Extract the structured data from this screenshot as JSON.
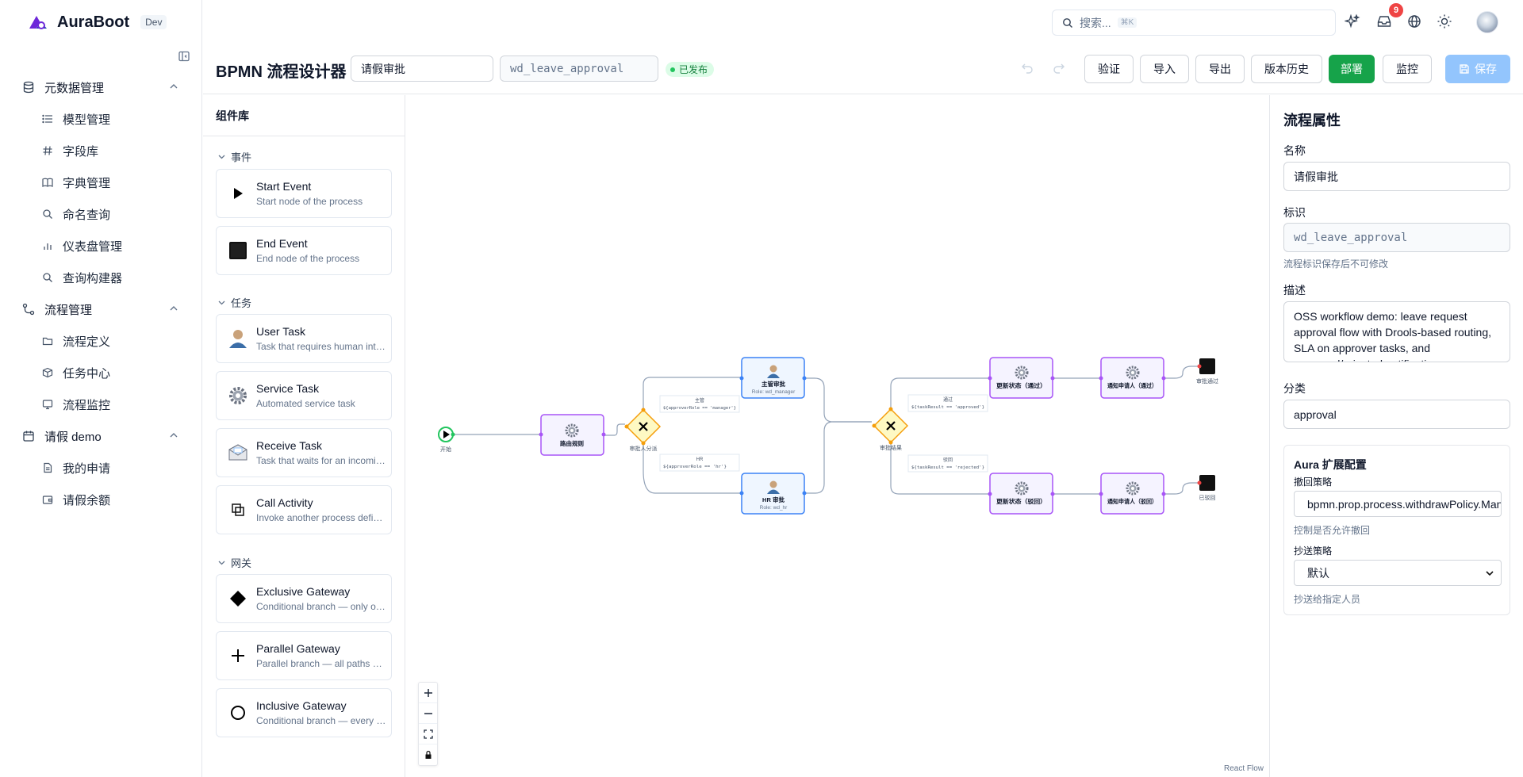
{
  "app": {
    "name": "AuraBoot",
    "env": "Dev"
  },
  "search": {
    "placeholder": "搜索...",
    "shortcut": "⌘K"
  },
  "notifications": {
    "count": "9"
  },
  "sidebar": {
    "groups": [
      {
        "label": "元数据管理",
        "items": [
          "模型管理",
          "字段库",
          "字典管理",
          "命名查询",
          "仪表盘管理",
          "查询构建器"
        ]
      },
      {
        "label": "流程管理",
        "items": [
          "流程定义",
          "任务中心",
          "流程监控"
        ]
      },
      {
        "label": "请假 demo",
        "items": [
          "我的申请",
          "请假余额"
        ]
      }
    ]
  },
  "designer": {
    "title": "BPMN 流程设计器",
    "name_value": "请假审批",
    "key_value": "wd_leave_approval",
    "status": "已发布",
    "buttons": {
      "validate": "验证",
      "import": "导入",
      "export": "导出",
      "history": "版本历史",
      "deploy": "部署",
      "monitor": "监控",
      "save": "保存"
    }
  },
  "palette": {
    "title": "组件库",
    "sections": {
      "events": "事件",
      "tasks": "任务",
      "gateways": "网关"
    },
    "items": [
      {
        "name": "Start Event",
        "desc": "Start node of the process"
      },
      {
        "name": "End Event",
        "desc": "End node of the process"
      },
      {
        "name": "User Task",
        "desc": "Task that requires human interaction"
      },
      {
        "name": "Service Task",
        "desc": "Automated service task"
      },
      {
        "name": "Receive Task",
        "desc": "Task that waits for an incoming message"
      },
      {
        "name": "Call Activity",
        "desc": "Invoke another process definition"
      },
      {
        "name": "Exclusive Gateway",
        "desc": "Conditional branch — only one path"
      },
      {
        "name": "Parallel Gateway",
        "desc": "Parallel branch — all paths execute"
      },
      {
        "name": "Inclusive Gateway",
        "desc": "Conditional branch — every matching path"
      }
    ]
  },
  "flow": {
    "start_label": "开始",
    "route_task": "路由规则",
    "gateway1_label": "审批人分派",
    "manager_task": "主管审批",
    "manager_role": "Role: wd_manager",
    "hr_task": "HR 审批",
    "hr_role": "Role: wd_hr",
    "edge_manager_title": "主管",
    "edge_manager_cond": "${approverRole == 'manager'}",
    "edge_hr_title": "HR",
    "edge_hr_cond": "${approverRole == 'hr'}",
    "gateway2_label": "审批结果",
    "edge_pass_title": "通过",
    "edge_pass_cond": "${taskResult == 'approved'}",
    "edge_reject_title": "驳回",
    "edge_reject_cond": "${taskResult == 'rejected'}",
    "update_approved": "更新状态（通过）",
    "notify_approved": "通知申请人（通过）",
    "end_approved": "审批通过",
    "update_rejected": "更新状态（驳回）",
    "notify_rejected": "通知申请人（驳回）",
    "end_rejected": "已驳回",
    "watermark": "React Flow"
  },
  "properties": {
    "title": "流程属性",
    "name_label": "名称",
    "name_value": "请假审批",
    "key_label": "标识",
    "key_value": "wd_leave_approval",
    "key_hint": "流程标识保存后不可修改",
    "desc_label": "描述",
    "desc_value": "OSS workflow demo: leave request approval flow with Drools-based routing, SLA on approver tasks, and approved/rejected notification",
    "category_label": "分类",
    "category_value": "approval",
    "aura": {
      "title": "Aura 扩展配置",
      "withdraw_label": "撤回策略",
      "withdraw_value": "bpmn.prop.process.withdrawPolicy.Manual",
      "withdraw_hint": "控制是否允许撤回",
      "cc_label": "抄送策略",
      "cc_value": "默认",
      "cc_hint": "抄送给指定人员"
    }
  },
  "colors": {
    "accent": "#16a34a",
    "save": "#93c5fd",
    "edge": "#94a3b8",
    "task_border": "#a855f7",
    "user_task_border": "#3b82f6",
    "gateway": "#f59e0b"
  }
}
